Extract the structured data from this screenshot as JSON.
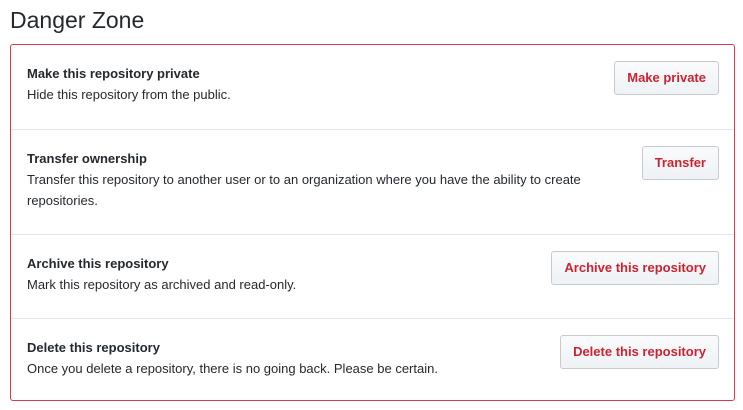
{
  "page": {
    "title": "Danger Zone"
  },
  "colors": {
    "danger": "#d73a49",
    "danger_text": "#cb2431",
    "divider": "#e1e4e8"
  },
  "actions": [
    {
      "heading": "Make this repository private",
      "description": "Hide this repository from the public.",
      "button_label": "Make private"
    },
    {
      "heading": "Transfer ownership",
      "description": "Transfer this repository to another user or to an organization where you have the ability to create repositories.",
      "button_label": "Transfer"
    },
    {
      "heading": "Archive this repository",
      "description": "Mark this repository as archived and read-only.",
      "button_label": "Archive this repository"
    },
    {
      "heading": "Delete this repository",
      "description": "Once you delete a repository, there is no going back. Please be certain.",
      "button_label": "Delete this repository"
    }
  ]
}
